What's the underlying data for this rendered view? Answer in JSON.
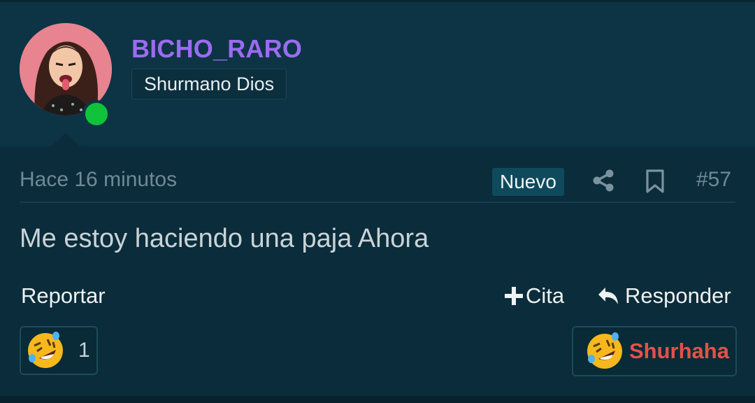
{
  "user": {
    "username": "BICHO_RARO",
    "rank": "Shurmano Dios",
    "online": true
  },
  "post": {
    "time": "Hace 16 minutos",
    "new_badge": "Nuevo",
    "number": "#57",
    "body": "Me estoy haciendo una paja Ahora"
  },
  "actions": {
    "report": "Reportar",
    "quote": "Cita",
    "reply": "Responder"
  },
  "reactions": {
    "count": "1",
    "button_label": "Shurhaha",
    "button_color": "#e2524a",
    "emoji": "rolling-on-floor-laughing-icon"
  },
  "icons": [
    "share-icon",
    "bookmark-icon",
    "plus-icon",
    "reply-arrow-icon"
  ],
  "colors": {
    "background": "#0b2c3a",
    "username": "#9b6cf0",
    "online": "#10c33a"
  }
}
